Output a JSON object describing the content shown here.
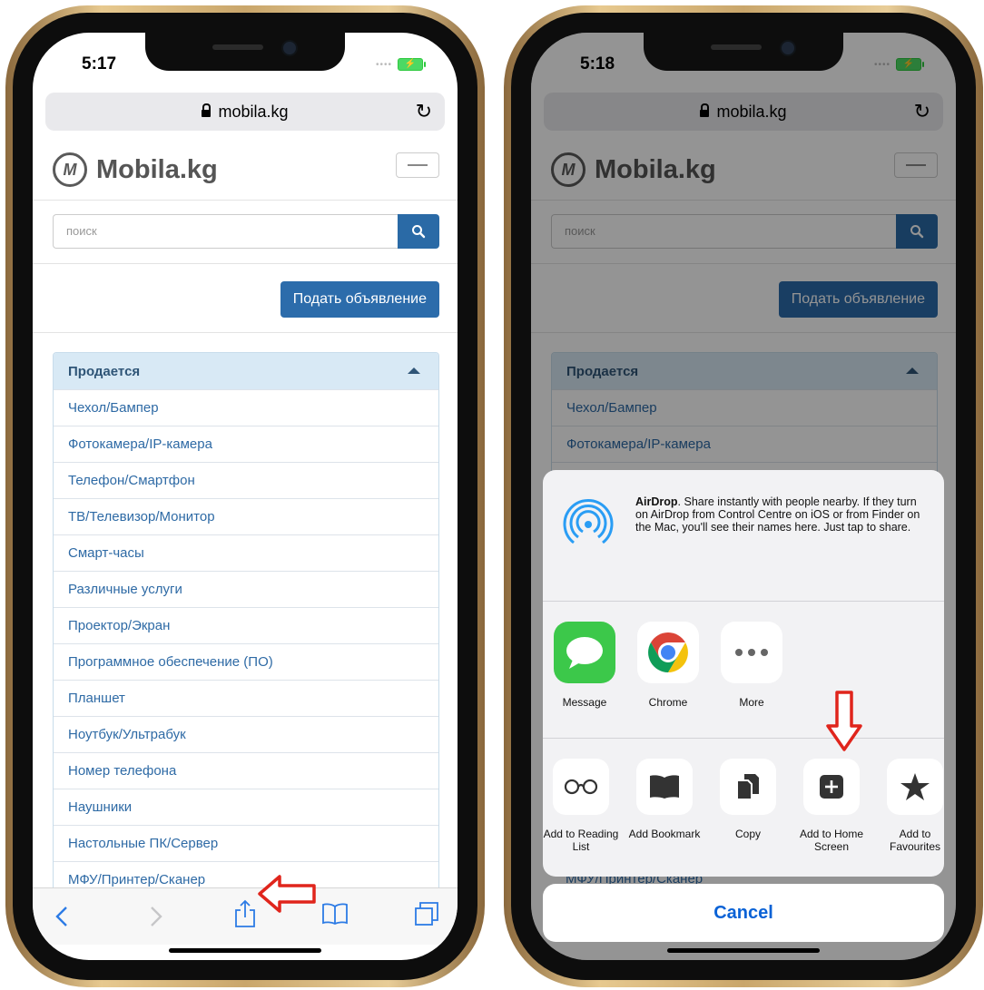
{
  "left_phone": {
    "status": {
      "time": "5:17"
    },
    "browser": {
      "url": "mobila.kg"
    },
    "site": {
      "logo_letter": "M",
      "logo_text": "Mobila.kg",
      "search_placeholder": "поиск",
      "post_button": "Подать объявление",
      "panel_title": "Продается",
      "categories": [
        "Чехол/Бампер",
        "Фотокамера/IP-камера",
        "Телефон/Смартфон",
        "ТВ/Телевизор/Монитор",
        "Смарт-часы",
        "Различные услуги",
        "Проектор/Экран",
        "Программное обеспечение (ПО)",
        "Планшет",
        "Ноутбук/Ультрабук",
        "Номер телефона",
        "Наушники",
        "Настольные ПК/Сервер",
        "МФУ/Принтер/Сканер"
      ]
    },
    "toolbar": {
      "icons": [
        "back-icon",
        "forward-icon",
        "share-icon",
        "bookmarks-icon",
        "tabs-icon"
      ]
    },
    "annotation": {
      "arrow_color": "#e0251c",
      "points_to": "share-icon"
    }
  },
  "right_phone": {
    "status": {
      "time": "5:18"
    },
    "browser": {
      "url": "mobila.kg"
    },
    "site": {
      "logo_letter": "M",
      "logo_text": "Mobila.kg",
      "search_placeholder": "поиск",
      "post_button": "Подать объявление",
      "panel_title": "Продается",
      "categories": [
        "Чехол/Бампер",
        "Фотокамера/IP-камера"
      ]
    },
    "share_sheet": {
      "airdrop_title": "AirDrop",
      "airdrop_text": ". Share instantly with people nearby. If they turn on AirDrop from Control Centre on iOS or from Finder on the Mac, you'll see their names here. Just tap to share.",
      "apps": [
        {
          "label": "Message",
          "icon": "messages-icon"
        },
        {
          "label": "Chrome",
          "icon": "chrome-icon"
        },
        {
          "label": "More",
          "icon": "more-icon"
        }
      ],
      "actions": [
        {
          "label": "Add to Reading List",
          "icon": "glasses-icon"
        },
        {
          "label": "Add Bookmark",
          "icon": "book-icon"
        },
        {
          "label": "Copy",
          "icon": "copy-icon"
        },
        {
          "label": "Add to Home Screen",
          "icon": "plus-square-icon"
        },
        {
          "label": "Add to Favourites",
          "icon": "star-icon"
        }
      ],
      "partial_text": "МФУ/Принтер/Сканер",
      "cancel": "Cancel"
    },
    "annotation": {
      "arrow_color": "#e0251c",
      "points_to": "Add to Home Screen"
    }
  }
}
